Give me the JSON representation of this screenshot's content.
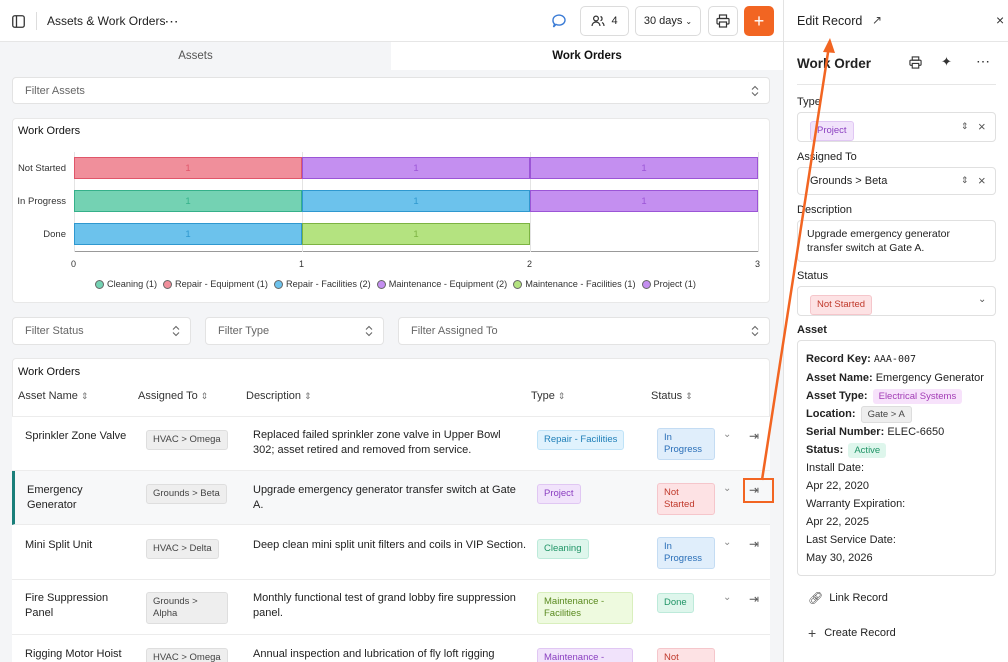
{
  "app": {
    "title": "Assets & Work Orders",
    "people_count": "4",
    "date_range": "30 days",
    "print_icon": "printer-icon",
    "add_icon": "plus-icon"
  },
  "tabs": [
    {
      "label": "Assets"
    },
    {
      "label": "Work Orders"
    }
  ],
  "filters": {
    "assets": "Filter Assets",
    "status": "Filter Status",
    "type": "Filter Type",
    "assigned": "Filter Assigned To"
  },
  "chart_data": {
    "type": "bar",
    "orientation": "horizontal",
    "stacked": true,
    "title": "Work Orders",
    "categories": [
      "Not Started",
      "In Progress",
      "Done"
    ],
    "xlim": [
      0,
      3
    ],
    "xticks": [
      "0",
      "1",
      "2",
      "3"
    ],
    "series": [
      {
        "name": "Cleaning (1)",
        "color": "#74d2b3",
        "values": [
          0,
          1,
          0
        ]
      },
      {
        "name": "Repair - Equipment (1)",
        "color": "#f08f9b",
        "values": [
          1,
          0,
          0
        ]
      },
      {
        "name": "Repair - Facilities (2)",
        "color": "#6cc2ec",
        "values": [
          0,
          1,
          1
        ]
      },
      {
        "name": "Maintenance - Equipment (2)",
        "color": "#c48ff0",
        "values": [
          1,
          0,
          0
        ]
      },
      {
        "name": "Maintenance - Facilities (1)",
        "color": "#b4e380",
        "values": [
          0,
          0,
          1
        ]
      },
      {
        "name": "Project (1)",
        "color": "#c48ff0",
        "values": [
          1,
          1,
          0
        ]
      }
    ],
    "bars": [
      [
        {
          "v": "1",
          "color": "#f08f9b",
          "border": "#e0566a"
        },
        {
          "v": "1",
          "color": "#c48ff0",
          "border": "#9b55d6"
        },
        {
          "v": "1",
          "color": "#c48ff0",
          "border": "#9b55d6"
        }
      ],
      [
        {
          "v": "1",
          "color": "#74d2b3",
          "border": "#35b08a"
        },
        {
          "v": "1",
          "color": "#6cc2ec",
          "border": "#2f98cf"
        },
        {
          "v": "1",
          "color": "#c48ff0",
          "border": "#9b55d6"
        }
      ],
      [
        {
          "v": "1",
          "color": "#6cc2ec",
          "border": "#2f98cf"
        },
        {
          "v": "1",
          "color": "#b4e380",
          "border": "#7cb342"
        }
      ]
    ],
    "legend_position": "bottom"
  },
  "table": {
    "title": "Work Orders",
    "headers": [
      "Asset Name",
      "Assigned To",
      "Description",
      "Type",
      "Status"
    ],
    "rows": [
      {
        "asset": "Sprinkler Zone Valve",
        "assigned": "HVAC > Omega",
        "desc": "Replaced failed sprinkler zone valve in Upper Bowl 302; asset retired and removed from service.",
        "type": "Repair - Facilities",
        "status": "In Progress"
      },
      {
        "asset": "Emergency Generator",
        "assigned": "Grounds > Beta",
        "desc": "Upgrade emergency generator transfer switch at Gate A.",
        "type": "Project",
        "status": "Not Started"
      },
      {
        "asset": "Mini Split Unit",
        "assigned": "HVAC > Delta",
        "desc": "Deep clean mini split unit filters and coils in VIP Section.",
        "type": "Cleaning",
        "status": "In Progress"
      },
      {
        "asset": "Fire Suppression Panel",
        "assigned": "Grounds > Alpha",
        "desc": "Monthly functional test of grand lobby fire suppression panel.",
        "type": "Maintenance - Facilities",
        "status": "Done"
      },
      {
        "asset": "Rigging Motor Hoist",
        "assigned": "HVAC > Omega",
        "desc": "Annual inspection and lubrication of fly loft rigging",
        "type": "Maintenance -",
        "status": "Not"
      }
    ]
  },
  "panel": {
    "header": "Edit Record",
    "title": "Work Order",
    "type_label": "Type",
    "type_value": "Project",
    "assigned_label": "Assigned To",
    "assigned_value": "Grounds > Beta",
    "desc_label": "Description",
    "desc_value": "Upgrade emergency generator transfer switch at Gate A.",
    "status_label": "Status",
    "status_value": "Not Started",
    "asset_label": "Asset",
    "asset": {
      "record_key_k": "Record Key:",
      "record_key_v": "AAA-007",
      "name_k": "Asset Name:",
      "name_v": "Emergency Generator",
      "type_k": "Asset Type:",
      "type_v": "Electrical Systems",
      "loc_k": "Location:",
      "loc_v": "Gate > A",
      "serial_k": "Serial Number:",
      "serial_v": "ELEC-6650",
      "status_k": "Status:",
      "status_v": "Active",
      "install_k": "Install Date:",
      "install_v": "Apr 22, 2020",
      "warranty_k": "Warranty Expiration:",
      "warranty_v": "Apr 22, 2025",
      "service_k": "Last Service Date:",
      "service_v": "May 30, 2026"
    },
    "link_record": "Link Record",
    "create_record": "Create Record"
  },
  "colors": {
    "accent": "#f26522",
    "teal": "#1a7f7a"
  }
}
